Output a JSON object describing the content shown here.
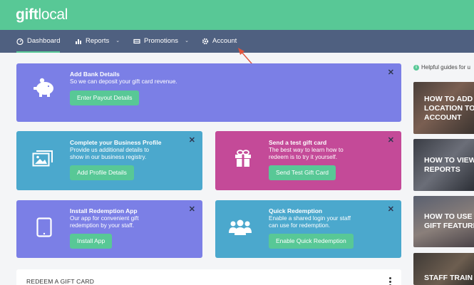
{
  "logo": {
    "bold": "gift",
    "light": "local"
  },
  "nav": {
    "items": [
      {
        "label": "Dashboard",
        "icon": "gauge-icon"
      },
      {
        "label": "Reports",
        "icon": "bar-chart-icon"
      },
      {
        "label": "Promotions",
        "icon": "ticket-icon"
      },
      {
        "label": "Account",
        "icon": "gear-icon"
      }
    ]
  },
  "cards": {
    "bank": {
      "title": "Add Bank Details",
      "desc": "So we can deposit your gift card revenue.",
      "button": "Enter Payout Details",
      "icon": "piggy-bank-icon"
    },
    "profile": {
      "title": "Complete your Business Profile",
      "desc1": "Provide us additional details to",
      "desc2": "show in our business registry.",
      "button": "Add Profile Details",
      "icon": "images-icon"
    },
    "test": {
      "title": "Send a test gift card",
      "desc1": "The best way to learn how to",
      "desc2": "redeem is to try it yourself.",
      "button": "Send Test Gift Card",
      "icon": "gift-icon"
    },
    "app": {
      "title": "Install Redemption App",
      "desc1": "Our app for convenient gift",
      "desc2": "redemption by your staff.",
      "button": "Install App",
      "icon": "tablet-icon"
    },
    "quick": {
      "title": "Quick Redemption",
      "desc1": "Enable a shared login your staff",
      "desc2": "can use for redemption.",
      "button": "Enable Quick Redemption",
      "icon": "users-icon"
    }
  },
  "redeem": {
    "label": "REDEEM A GIFT CARD"
  },
  "guides": {
    "header": "Helpful guides for u",
    "items": [
      {
        "line1": "HOW TO ADD",
        "line2": "LOCATION TO",
        "line3": "ACCOUNT"
      },
      {
        "line1": "HOW TO VIEW",
        "line2": "REPORTS"
      },
      {
        "line1": "HOW TO USE",
        "line2": "GIFT FEATURE"
      },
      {
        "line1": "STAFF TRAIN"
      }
    ]
  },
  "colors": {
    "green": "#58c896",
    "nav": "#4f6080",
    "purple": "#7b7fe6",
    "teal": "#4ba8cd",
    "magenta": "#c44a98",
    "arrow": "#e0533b"
  }
}
